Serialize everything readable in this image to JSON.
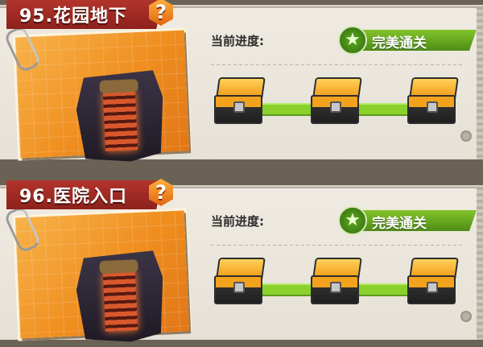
{
  "colors": {
    "title_tab": "#9e2a23",
    "badge_green": "#6aab22",
    "track_green": "#8bd12d",
    "photo_orange": "#ef8e1f",
    "chest_gold": "#f3a21d"
  },
  "levels": [
    {
      "title": "95.花园地下",
      "help_glyph": "?",
      "progress_label": "当前进度:",
      "status": "完美通关",
      "star_glyph": "★",
      "chests": [
        "chest-icon",
        "chest-icon",
        "chest-icon"
      ]
    },
    {
      "title": "96.医院入口",
      "help_glyph": "?",
      "progress_label": "当前进度:",
      "status": "完美通关",
      "star_glyph": "★",
      "chests": [
        "chest-icon",
        "chest-icon",
        "chest-icon"
      ]
    }
  ]
}
